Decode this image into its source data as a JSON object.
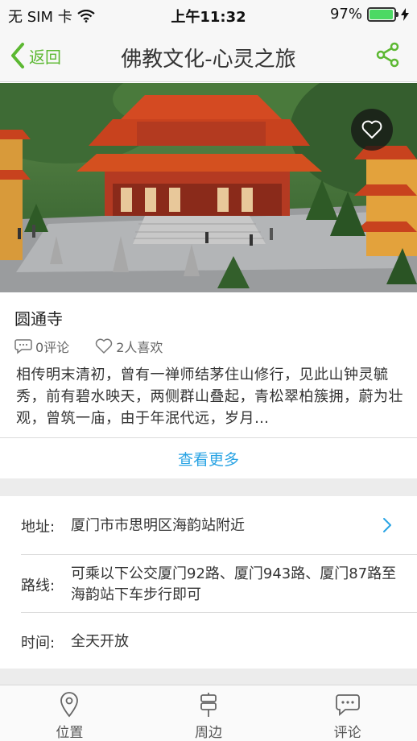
{
  "status_bar": {
    "carrier": "无 SIM 卡",
    "time": "上午11:32",
    "battery_percent": "97%",
    "battery_level": 0.97,
    "battery_color": "#4cd964"
  },
  "nav": {
    "back_label": "返回",
    "title": "佛教文化-心灵之旅",
    "accent_color": "#5cb832"
  },
  "place": {
    "name": "圆通寺",
    "comments": "0评论",
    "likes": "2人喜欢",
    "description": "相传明末清初，曾有一禅师结茅住山修行，见此山钟灵毓秀，前有碧水映天，两侧群山叠起，青松翠柏簇拥，蔚为壮观，曾筑一庙，由于年泯代远，岁月…"
  },
  "more_label": "查看更多",
  "info": {
    "address_label": "地址:",
    "address": "厦门市市思明区海韵站附近",
    "route_label": "路线:",
    "route": "可乘以下公交厦门92路、厦门943路、厦门87路至海韵站下车步行即可",
    "time_label": "时间:",
    "time": "全天开放"
  },
  "tabs": [
    {
      "label": "位置",
      "icon": "location-pin-icon"
    },
    {
      "label": "周边",
      "icon": "signpost-icon"
    },
    {
      "label": "评论",
      "icon": "chat-bubble-icon"
    }
  ]
}
